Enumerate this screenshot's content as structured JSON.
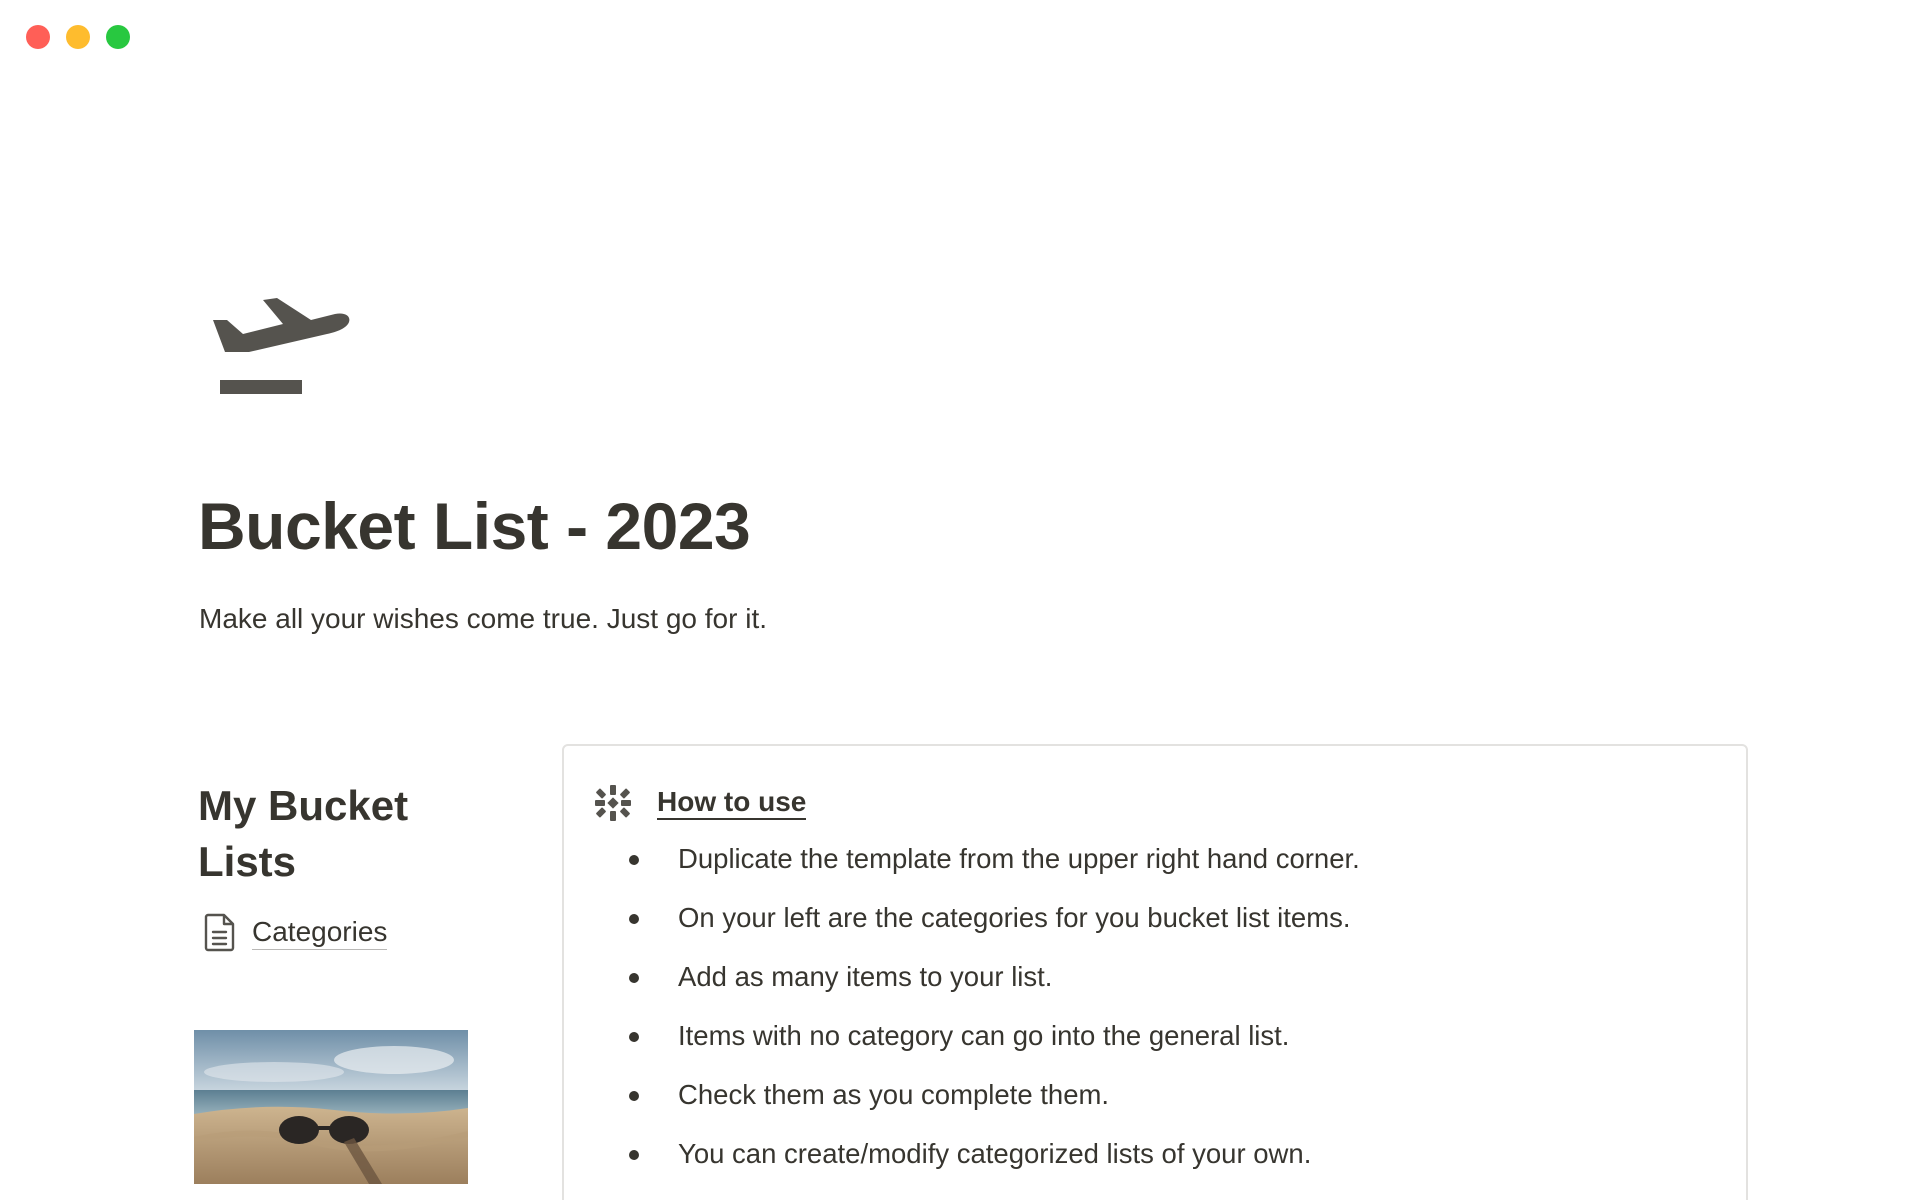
{
  "window": {
    "controls": [
      {
        "name": "close-window-button",
        "color": "#ff5f57"
      },
      {
        "name": "minimize-window-button",
        "color": "#febc2e"
      },
      {
        "name": "zoom-window-button",
        "color": "#28c840"
      }
    ]
  },
  "page": {
    "icon": "airplane-departure-icon",
    "title": "Bucket List - 2023",
    "subtitle": "Make all your wishes come true. Just go for it."
  },
  "sidebar": {
    "heading": "My Bucket Lists",
    "link": {
      "icon": "document-icon",
      "label": "Categories"
    },
    "cover_image": "beach-sunglasses-image"
  },
  "callout": {
    "icon": "sparkle-asterisk-icon",
    "title": "How to use",
    "items": [
      "Duplicate the template from the upper right hand corner.",
      "On your left are the categories for you bucket list items.",
      "Add as many items to your list.",
      "Items with no category can go into the general list.",
      "Check them as you complete them.",
      "You can create/modify categorized lists of your own."
    ]
  },
  "colors": {
    "text": "#37352f",
    "icon_gray": "#55534e",
    "border": "#e3e2e0"
  }
}
